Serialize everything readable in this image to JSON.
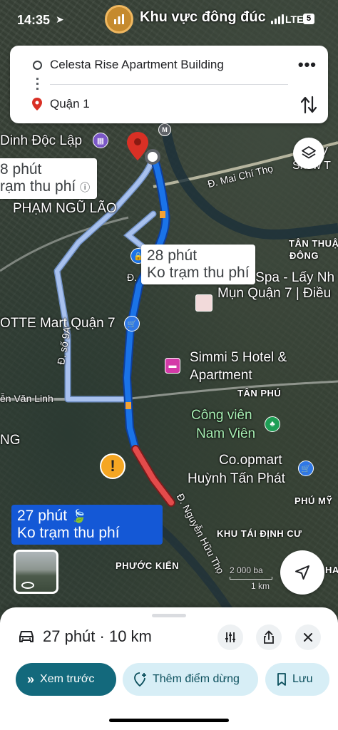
{
  "status_bar": {
    "time": "14:35",
    "network": "LTE",
    "battery": "5"
  },
  "place_header": {
    "name": "Khu vực đông đúc"
  },
  "route_card": {
    "origin": "Celesta Rise Apartment Building",
    "destination": "Quận 1"
  },
  "map": {
    "labels": {
      "dinh_doc_lap": "Dinh Độc Lập",
      "pham_ngu_lao": "PHẠM NGŨ LÃO",
      "mai_chi_tho": "Đ. Mai Chí Thọ",
      "le_vy_spa_1": "Lê Vy Spa - Lấy Nh",
      "le_vy_spa_2": "Mụn Quận 7 | Điều",
      "lotte": "OTTE Mart Quận 7",
      "simmi_1": "Simmi 5 Hotel &",
      "simmi_2": "Apartment",
      "tan_phu": "TÂN PHÚ",
      "cong_vien_1": "Công viên",
      "cong_vien_2": "Nam Viên",
      "coopmart_1": "Co.opmart",
      "coopmart_2": "Huỳnh Tấn Phát",
      "phu_my": "PHÚ MỸ",
      "khu_tai_dinh_cu": "KHU TÁI ĐỊNH CƯ",
      "phuoc_kien": "PHƯỚC KIỂN",
      "nguyen_huu_tho": "Đ. Nguyễn Hữu Thọ",
      "nguyen_van_linh": "ễn Văn Linh",
      "duong_so_9a": "Đ. số 9A",
      "tan_thuan_1": "TÂN THUẬN",
      "tan_thuan_2": "ĐÔNG",
      "show_1": "u V",
      "show_2": "Show T",
      "ng": "NG",
      "d_short": "Đ.",
      "ha": "HA"
    },
    "alt_route_1": {
      "time": "8 phút",
      "toll": "rạm thu phí"
    },
    "alt_route_2": {
      "time": "28 phút",
      "toll": "Ko trạm thu phí"
    },
    "main_route": {
      "time": "27 phút",
      "toll": "Ko trạm thu phí"
    },
    "scale": {
      "feet": "2 000 ba",
      "km": "1 km"
    },
    "warning_symbol": "!"
  },
  "sheet": {
    "summary": "27 phút · 10 km",
    "preview_label": "Xem trước",
    "add_stop_label": "Thêm điểm dừng",
    "save_label": "Lưu"
  },
  "colors": {
    "main_route": "#1a73e8",
    "alt_route": "#9ab7e8",
    "traffic_red": "#e34b4b",
    "primary_button": "#13697c",
    "secondary_chip": "#d7eef6"
  }
}
